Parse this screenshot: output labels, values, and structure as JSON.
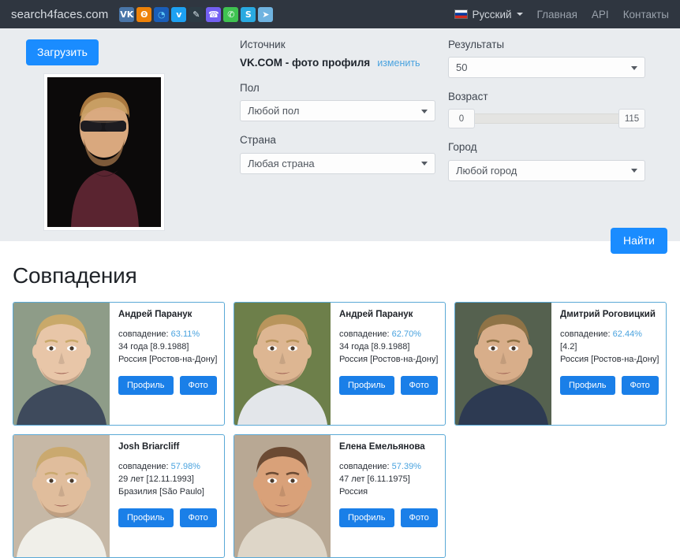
{
  "navbar": {
    "brand": "search4faces.com",
    "social_icons": [
      {
        "name": "vk-icon",
        "glyph": "VK",
        "bg": "#4a76a8",
        "fg": "#ffffff"
      },
      {
        "name": "odnoklassniki-icon",
        "glyph": "Θ",
        "bg": "#ee8208",
        "fg": "#ffffff"
      },
      {
        "name": "moimir-icon",
        "glyph": "◔",
        "bg": "#1a5eb8",
        "fg": "#5ec8f5"
      },
      {
        "name": "twitter-icon",
        "glyph": "ᴠ",
        "bg": "#1da1f2",
        "fg": "#ffffff"
      },
      {
        "name": "tiktok-icon",
        "glyph": "✎",
        "bg": "#2c3b44",
        "fg": "#d9e6ec"
      },
      {
        "name": "viber-icon",
        "glyph": "☎",
        "bg": "#7360f2",
        "fg": "#ffffff"
      },
      {
        "name": "whatsapp-icon",
        "glyph": "✆",
        "bg": "#3fc351",
        "fg": "#ffffff"
      },
      {
        "name": "skype-icon",
        "glyph": "S",
        "bg": "#29aae1",
        "fg": "#ffffff"
      },
      {
        "name": "telegram-icon",
        "glyph": "➤",
        "bg": "#6fb3e0",
        "fg": "#ffffff"
      }
    ],
    "language": "Русский",
    "links": [
      {
        "name": "nav-link-home",
        "label": "Главная"
      },
      {
        "name": "nav-link-api",
        "label": "API"
      },
      {
        "name": "nav-link-contacts",
        "label": "Контакты"
      }
    ]
  },
  "search_panel": {
    "upload_label": "Загрузить",
    "source_label": "Источник",
    "source_value": "VK.COM - фото профиля",
    "source_change": "изменить",
    "gender_label": "Пол",
    "gender_value": "Любой пол",
    "country_label": "Страна",
    "country_value": "Любая страна",
    "results_label": "Результаты",
    "results_value": "50",
    "age_label": "Возраст",
    "age_min": "0",
    "age_max": "115",
    "city_label": "Город",
    "city_value": "Любой город",
    "find_label": "Найти"
  },
  "matches": {
    "title": "Совпадения",
    "score_prefix": "совпадение: ",
    "profile_label": "Профиль",
    "photo_label": "Фото",
    "cards": [
      {
        "name": "Андрей Паранук",
        "score": "63.11%",
        "age": "34 года [8.9.1988]",
        "location": "Россия [Ростов-на-Дону]"
      },
      {
        "name": "Андрей Паранук",
        "score": "62.70%",
        "age": "34 года [8.9.1988]",
        "location": "Россия [Ростов-на-Дону]"
      },
      {
        "name": "Дмитрий Роговицкий",
        "score": "62.44%",
        "age": "[4.2]",
        "location": "Россия [Ростов-на-Дону]"
      },
      {
        "name": "Josh Briarcliff",
        "score": "57.98%",
        "age": "29 лет [12.11.1993]",
        "location": "Бразилия [São Paulo]"
      },
      {
        "name": "Елена Емельянова",
        "score": "57.39%",
        "age": "47 лет [6.11.1975]",
        "location": "Россия"
      }
    ]
  },
  "colors": {
    "navbar_bg": "#2f3640",
    "panel_bg": "#e9ecef",
    "accent_blue": "#1a8cff",
    "link_blue": "#4aa3df",
    "card_border": "#5aa9d6"
  }
}
